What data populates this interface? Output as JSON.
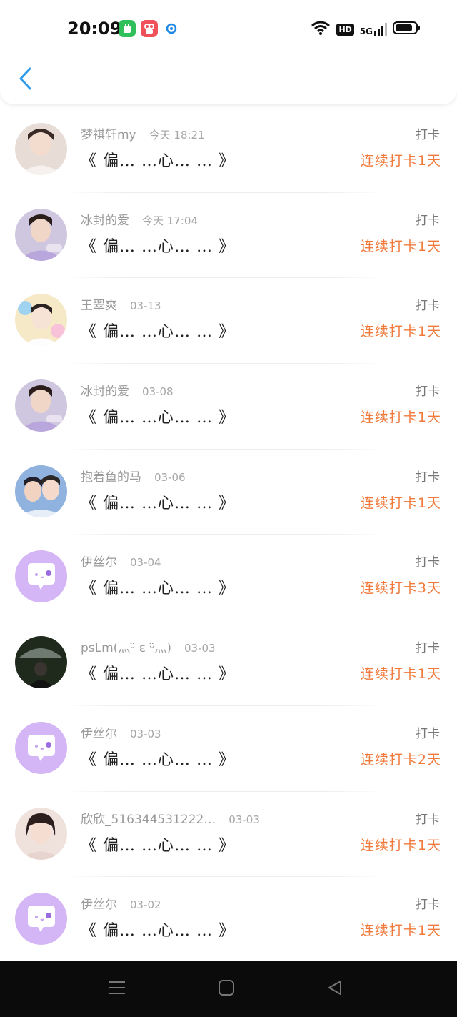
{
  "status_bar": {
    "time": "20:09",
    "hd": "HD",
    "network": "5G",
    "icons": [
      "wechat-mini-icon",
      "kuaishou-icon",
      "qq-browser-icon",
      "wifi-icon",
      "signal-icon",
      "battery-icon"
    ]
  },
  "header": {
    "back_icon": "chevron-left-icon"
  },
  "colors": {
    "accent": "#f07a3c",
    "back_arrow": "#2f9bea",
    "avatar_placeholder": "#d4b5f5"
  },
  "rows": [
    {
      "name": "梦祺轩my",
      "date": "今天 18:21",
      "content": "《 偏… …心… … 》",
      "type": "打卡",
      "streak": "连续打卡1天",
      "avatar": "photo-1"
    },
    {
      "name": "冰封的爱",
      "date": "今天 17:04",
      "content": "《 偏… …心… … 》",
      "type": "打卡",
      "streak": "连续打卡1天",
      "avatar": "photo-2"
    },
    {
      "name": "王翠爽",
      "date": "03-13",
      "content": "《 偏… …心… … 》",
      "type": "打卡",
      "streak": "连续打卡1天",
      "avatar": "photo-3"
    },
    {
      "name": "冰封的爱",
      "date": "03-08",
      "content": "《 偏… …心… … 》",
      "type": "打卡",
      "streak": "连续打卡1天",
      "avatar": "photo-2"
    },
    {
      "name": "抱着鱼的马",
      "date": "03-06",
      "content": "《 偏… …心… … 》",
      "type": "打卡",
      "streak": "连续打卡1天",
      "avatar": "photo-4"
    },
    {
      "name": "伊丝尔",
      "date": "03-04",
      "content": "《 偏… …心… … 》",
      "type": "打卡",
      "streak": "连续打卡3天",
      "avatar": "placeholder"
    },
    {
      "name": "psLm(灬ᵕ̈ ε ᵕ̈灬)",
      "date": "03-03",
      "content": "《 偏… …心… … 》",
      "type": "打卡",
      "streak": "连续打卡1天",
      "avatar": "photo-5"
    },
    {
      "name": "伊丝尔",
      "date": "03-03",
      "content": "《 偏… …心… … 》",
      "type": "打卡",
      "streak": "连续打卡2天",
      "avatar": "placeholder"
    },
    {
      "name": "欣欣_516344531222…",
      "date": "03-03",
      "content": "《 偏… …心… … 》",
      "type": "打卡",
      "streak": "连续打卡1天",
      "avatar": "photo-6"
    },
    {
      "name": "伊丝尔",
      "date": "03-02",
      "content": "《 偏… …心… … 》",
      "type": "打卡",
      "streak": "连续打卡1天",
      "avatar": "placeholder"
    }
  ],
  "nav_bar": {
    "icons": [
      "menu-icon",
      "home-icon",
      "back-triangle-icon"
    ]
  }
}
